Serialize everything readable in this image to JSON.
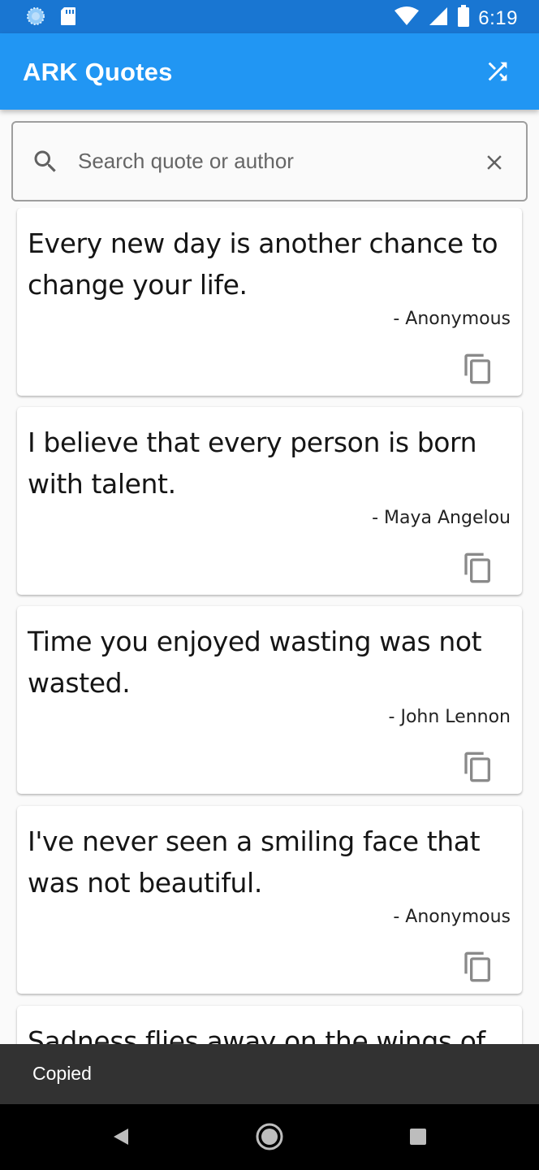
{
  "status_bar": {
    "time": "6:19",
    "icons": [
      "app-notification-icon",
      "sd-card-icon",
      "wifi-icon",
      "cell-signal-icon",
      "battery-icon"
    ]
  },
  "app_bar": {
    "title": "ARK Quotes",
    "action_icon": "shuffle-icon"
  },
  "search": {
    "placeholder": "Search quote or author",
    "value": "",
    "leading_icon": "search-icon",
    "trailing_icon": "close-icon"
  },
  "quotes": [
    {
      "text": "Every new day is another chance to change your life.",
      "author": "- Anonymous"
    },
    {
      "text": "I believe that every person is born with talent.",
      "author": "- Maya Angelou"
    },
    {
      "text": "Time you enjoyed wasting was not wasted.",
      "author": "- John Lennon"
    },
    {
      "text": "I've never seen a smiling face that was not beautiful.",
      "author": "- Anonymous"
    },
    {
      "text": "Sadness flies away on the wings of",
      "author": ""
    }
  ],
  "snackbar": {
    "message": "Copied"
  },
  "colors": {
    "status_bar": "#1976d2",
    "app_bar": "#2196f3",
    "snackbar": "#323232",
    "background": "#fafafa"
  }
}
